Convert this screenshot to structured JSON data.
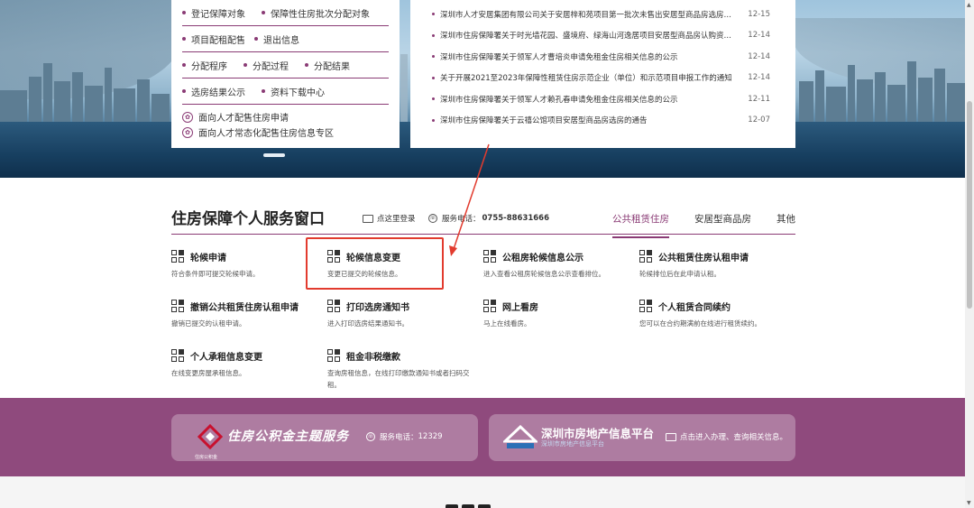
{
  "left_menu": {
    "rows": [
      [
        "登记保障对象",
        "保障性住房批次分配对象"
      ],
      [
        "项目配租配售",
        "退出信息"
      ],
      [
        "分配程序",
        "分配过程",
        "分配结果"
      ],
      [
        "选房结果公示",
        "资料下载中心"
      ]
    ],
    "special": [
      "面向人才配售住房申请",
      "面向人才常态化配售住房信息专区"
    ]
  },
  "news": [
    {
      "title": "深圳市人才安居集团有限公司关于安居梓和苑项目第一批次未售出安居型商品房选房有关...",
      "date": "12-15"
    },
    {
      "title": "深圳市住房保障署关于时光墙花园、盛境府、绿海山河逸居项目安居型商品房认购资格...",
      "date": "12-14"
    },
    {
      "title": "深圳市住房保障署关于领军人才曹培炎申请免租金住房相关信息的公示",
      "date": "12-14"
    },
    {
      "title": "关于开展2021至2023年保障性租赁住房示范企业（单位）和示范项目申报工作的通知",
      "date": "12-14"
    },
    {
      "title": "深圳市住房保障署关于领军人才赖孔春申请免租金住房相关信息的公示",
      "date": "12-11"
    },
    {
      "title": "深圳市住房保障署关于云禧公馆项目安居型商品房选房的通告",
      "date": "12-07"
    }
  ],
  "service": {
    "title": "住房保障个人服务窗口",
    "login": "点这里登录",
    "phone_label": "服务电话：",
    "phone": "0755-88631666",
    "tabs": [
      "公共租赁住房",
      "安居型商品房",
      "其他"
    ],
    "active_tab": "公共租赁住房",
    "cards": [
      {
        "title": "轮候申请",
        "desc": "符合条件即可提交轮候申请。"
      },
      {
        "title": "轮候信息变更",
        "desc": "变更已提交的轮候信息。"
      },
      {
        "title": "公租房轮候信息公示",
        "desc": "进入查看公租房轮候信息公示查看排位。"
      },
      {
        "title": "公共租赁住房认租申请",
        "desc": "轮候排位后在此申请认租。"
      },
      {
        "title": "撤销公共租赁住房认租申请",
        "desc": "撤销已提交的认租申请。"
      },
      {
        "title": "打印选房通知书",
        "desc": "进入打印选房结果通知书。"
      },
      {
        "title": "网上看房",
        "desc": "马上在线看房。"
      },
      {
        "title": "个人租赁合同续约",
        "desc": "您可以在合约期满前在线进行租赁续约。"
      },
      {
        "title": "个人承租信息变更",
        "desc": "在线变更房屋承租信息。"
      },
      {
        "title": "租金非税缴款",
        "desc": "查询房租信息，在线打印缴款通知书或者扫码交租。"
      }
    ]
  },
  "promos": {
    "gjj": {
      "logo_caption": "住房公积金",
      "title": "住房公积金主题服务",
      "phone_label": "服务电话：",
      "phone": "12329"
    },
    "fdc": {
      "title": "深圳市房地产信息平台",
      "sub": "深圳市房地产信息平台",
      "enter": "点击进入办理、查询相关信息。"
    }
  },
  "colors": {
    "accent": "#8a3b75",
    "band": "#8f4a7d",
    "highlight": "#e23b2e"
  }
}
